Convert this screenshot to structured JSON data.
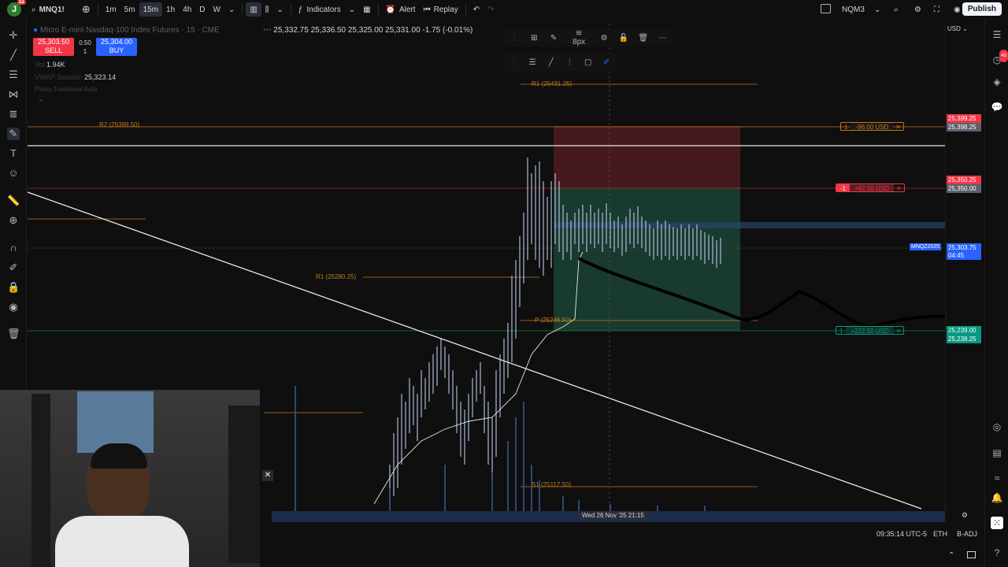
{
  "topbar": {
    "avatar_letter": "J",
    "avatar_badge": "11",
    "symbol": "MNQ1!",
    "intervals": [
      "1m",
      "5m",
      "15m",
      "1h",
      "4h",
      "D",
      "W"
    ],
    "active_interval": "15m",
    "indicators_label": "Indicators",
    "alert_label": "Alert",
    "replay_label": "Replay",
    "contract_label": "NQM3",
    "publish_label": "Publish"
  },
  "legend": {
    "title": "Micro E-mini Nasdaq-100 Index Futures · 15 · CME",
    "open": "25,332.75",
    "high": "25,336.50",
    "low": "25,325.00",
    "close": "25,331.00",
    "change": "-1.75 (-0.01%)"
  },
  "trade": {
    "sell_price": "25,303.50",
    "sell_label": "SELL",
    "buy_price": "25,304.00",
    "buy_label": "BUY",
    "spread": "0.50",
    "qty": "1"
  },
  "indicators": {
    "vol_label": "Vol",
    "vol_value": "1.94K",
    "vwap_label": "VWAP Session",
    "vwap_value": "25,323.14",
    "pivots_label": "Pivots Traditional Auto"
  },
  "drawing_toolbar": {
    "width_label": "8px"
  },
  "levels": {
    "r1_top": "R1 (25431.25)",
    "r2": "R2 (25399.50)",
    "r1_mid": "R1 (25280.25)",
    "p": "P (25246.50)",
    "s1": "S1 (25117.50)"
  },
  "positions": [
    {
      "qty": "1",
      "pnl": "-96.00 USD"
    },
    {
      "qty": "-1",
      "pnl": "+92.50 USD"
    },
    {
      "qty": "1",
      "pnl": "+222.50 USD"
    }
  ],
  "price_axis": {
    "currency": "USD",
    "labels": [
      {
        "text": "25,399.25",
        "color": "#f23645"
      },
      {
        "text": "25,398.25",
        "color": "#5d606b"
      },
      {
        "text": "25,350.25",
        "color": "#f23645"
      },
      {
        "text": "25,350.00",
        "color": "#5d606b"
      },
      {
        "text": "25,303.75",
        "color": "#2962ff"
      },
      {
        "text": "04:45",
        "color": "#2962ff"
      },
      {
        "text": "25,239.00",
        "color": "#089981"
      },
      {
        "text": "25,238.25",
        "color": "#089981"
      }
    ],
    "symbol_tag": "MNQZ2025"
  },
  "time_axis": {
    "cursor_label": "Wed 26 Nov '25   21:15"
  },
  "bottom_bar": {
    "clock": "09:35:14 UTC-5",
    "session": "ETH",
    "adj": "B-ADJ"
  },
  "right_badge": "45"
}
